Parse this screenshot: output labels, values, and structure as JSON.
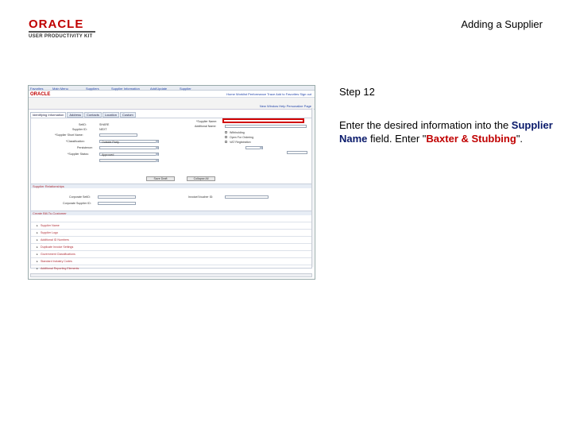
{
  "logo": {
    "brand": "ORACLE",
    "kit": "USER PRODUCTIVITY KIT"
  },
  "slide": {
    "title": "Adding a Supplier"
  },
  "step": {
    "label": "Step 12"
  },
  "instruction": {
    "part1": "Enter the desired information into the ",
    "field": "Supplier Name",
    "part2": " field. Enter \"",
    "value": "Baxter & Stubbing",
    "part3": "\"."
  },
  "screenshot": {
    "top_links": [
      "Favorites",
      "Main Menu",
      "Suppliers",
      "Supplier Information",
      "Add/Update",
      "Supplier"
    ],
    "brand": "ORACLE",
    "header_links": "Home  Worklist  Performance Trace  Add to Favorites  Sign out",
    "nav_link": "New Window  Help  Personalize Page",
    "tabs": [
      "Identifying Information",
      "Address",
      "Contacts",
      "Location",
      "Custom"
    ],
    "fields_left": [
      "SetID:",
      "Supplier ID:",
      "*Supplier Short Name:",
      "*Classification:",
      "Persistence:",
      "*Supplier Status:"
    ],
    "field_values_left": [
      "SHARE",
      "NEXT",
      "",
      "Outside Party",
      "",
      "Approved"
    ],
    "fields_right": [
      "*Supplier Name:",
      "Additional Name:"
    ],
    "checks_right": [
      "Withholding",
      "Open For Ordering",
      "VAT Registration"
    ],
    "buttons": [
      "Save Draft",
      "Collapse All"
    ],
    "sections": {
      "relationships": "Supplier Relationships",
      "corporate_setid": "Corporate SetID:",
      "corporate_id": "Corporate Supplier ID:",
      "invoice": "Invoice/Voucher ID:",
      "create": "Create Bill-To-Customer"
    },
    "rows": [
      "Supplier Name",
      "Supplier Logo",
      "Additional ID Numbers",
      "Duplicate Invoice Settings",
      "Government Classifications",
      "Standard Industry Codes",
      "Additional Reporting Elements"
    ]
  }
}
